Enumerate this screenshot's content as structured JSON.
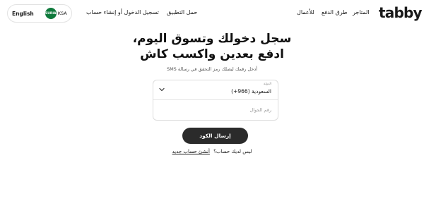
{
  "header": {
    "logo": "tabby",
    "nav": {
      "stores": "المتاجر",
      "payment_methods": "طرق الدفع",
      "business": "للأعمال",
      "download_app": "حمل التطبيق",
      "login_signup": "تسجيل الدخول أو إنشاء حساب"
    },
    "locale": {
      "language": "English",
      "flag_text": "SURIA",
      "country": "KSA"
    }
  },
  "main": {
    "headline_line1": "سجل دخولك وتسوق اليوم،",
    "headline_line2": "ادفع بعدين واكسب كاش",
    "subtitle": "أدخل رقمك ليصلك رمز التحقق في رسالة SMS"
  },
  "form": {
    "country_label": "الدولة",
    "country_value": "السعودية (966+)",
    "phone_placeholder": "رقم الجوال",
    "phone_value": "",
    "send_button": "إرسال الكود"
  },
  "signup": {
    "question": "ليس لديك حساب؟",
    "link": "أنشئ حساب جديد"
  },
  "colors": {
    "button": "#2b2b2b",
    "flag": "#0f7a3c"
  },
  "icons": [
    "chevron-down-icon",
    "saudi-flag-icon"
  ]
}
